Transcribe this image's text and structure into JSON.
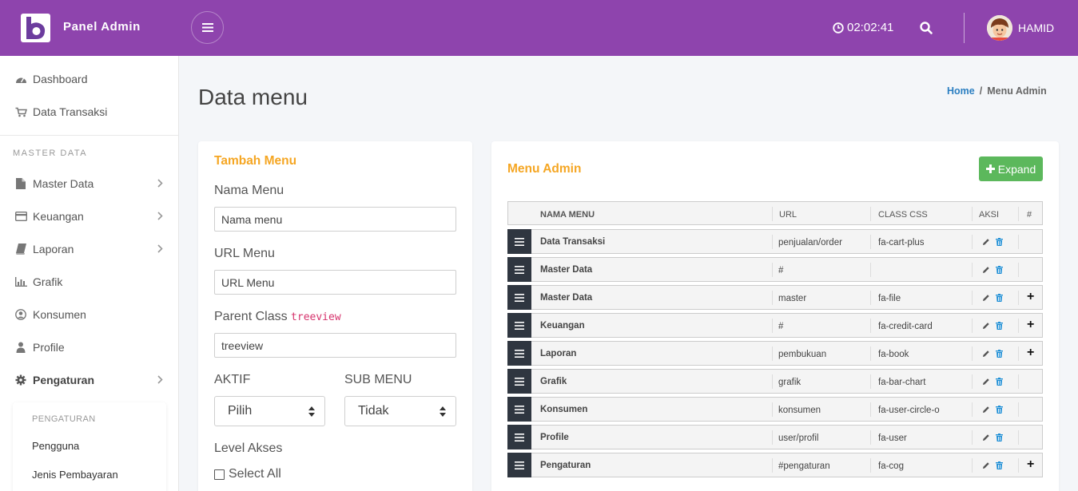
{
  "header": {
    "brand": "Panel Admin",
    "clock": "02:02:41",
    "user": "HAMID"
  },
  "sidebar": {
    "items_top": [
      {
        "label": "Dashboard",
        "icon": "dashboard-icon"
      },
      {
        "label": "Data Transaksi",
        "icon": "cart-icon"
      }
    ],
    "section_header": "MASTER DATA",
    "items": [
      {
        "label": "Master Data",
        "icon": "file-icon"
      },
      {
        "label": "Keuangan",
        "icon": "credit-card-icon"
      },
      {
        "label": "Laporan",
        "icon": "book-icon"
      },
      {
        "label": "Grafik",
        "icon": "bar-chart-icon"
      },
      {
        "label": "Konsumen",
        "icon": "user-circle-icon"
      },
      {
        "label": "Profile",
        "icon": "user-icon"
      },
      {
        "label": "Pengaturan",
        "icon": "cog-icon"
      }
    ],
    "submenu": {
      "header": "PENGATURAN",
      "items": [
        "Pengguna",
        "Jenis Pembayaran"
      ]
    }
  },
  "page": {
    "title": "Data menu",
    "breadcrumb_home": "Home",
    "breadcrumb_current": "Menu Admin"
  },
  "form": {
    "title": "Tambah Menu",
    "nama_label": "Nama Menu",
    "nama_placeholder": "Nama menu",
    "url_label": "URL Menu",
    "url_placeholder": "URL Menu",
    "parent_label": "Parent Class",
    "parent_code": "treeview",
    "parent_value": "treeview",
    "aktif_label": "AKTIF",
    "aktif_value": "Pilih",
    "submenu_label": "SUB MENU",
    "submenu_value": "Tidak",
    "level_label": "Level Akses",
    "select_all": "Select All"
  },
  "menu_admin": {
    "title": "Menu Admin",
    "expand_label": "Expand",
    "columns": {
      "name": "NAMA MENU",
      "url": "URL",
      "css": "CLASS CSS",
      "aksi": "AKSI",
      "hash": "#"
    },
    "rows": [
      {
        "name": "Data Transaksi",
        "url": "penjualan/order",
        "css": "fa-cart-plus",
        "expandable": false
      },
      {
        "name": "Master Data",
        "url": "#",
        "css": "",
        "expandable": false
      },
      {
        "name": "Master Data",
        "url": "master",
        "css": "fa-file",
        "expandable": true
      },
      {
        "name": "Keuangan",
        "url": "#",
        "css": "fa-credit-card",
        "expandable": true
      },
      {
        "name": "Laporan",
        "url": "pembukuan",
        "css": "fa-book",
        "expandable": true
      },
      {
        "name": "Grafik",
        "url": "grafik",
        "css": "fa-bar-chart",
        "expandable": false
      },
      {
        "name": "Konsumen",
        "url": "konsumen",
        "css": "fa-user-circle-o",
        "expandable": false
      },
      {
        "name": "Profile",
        "url": "user/profil",
        "css": "fa-user",
        "expandable": false
      },
      {
        "name": "Pengaturan",
        "url": "#pengaturan",
        "css": "fa-cog",
        "expandable": true
      }
    ]
  },
  "colors": {
    "topbar": "#8e44ad",
    "accent_orange": "#f5a623",
    "expand_green": "#5cb85c",
    "link_blue": "#2a7ec1",
    "handle_dark": "#2f3640"
  }
}
